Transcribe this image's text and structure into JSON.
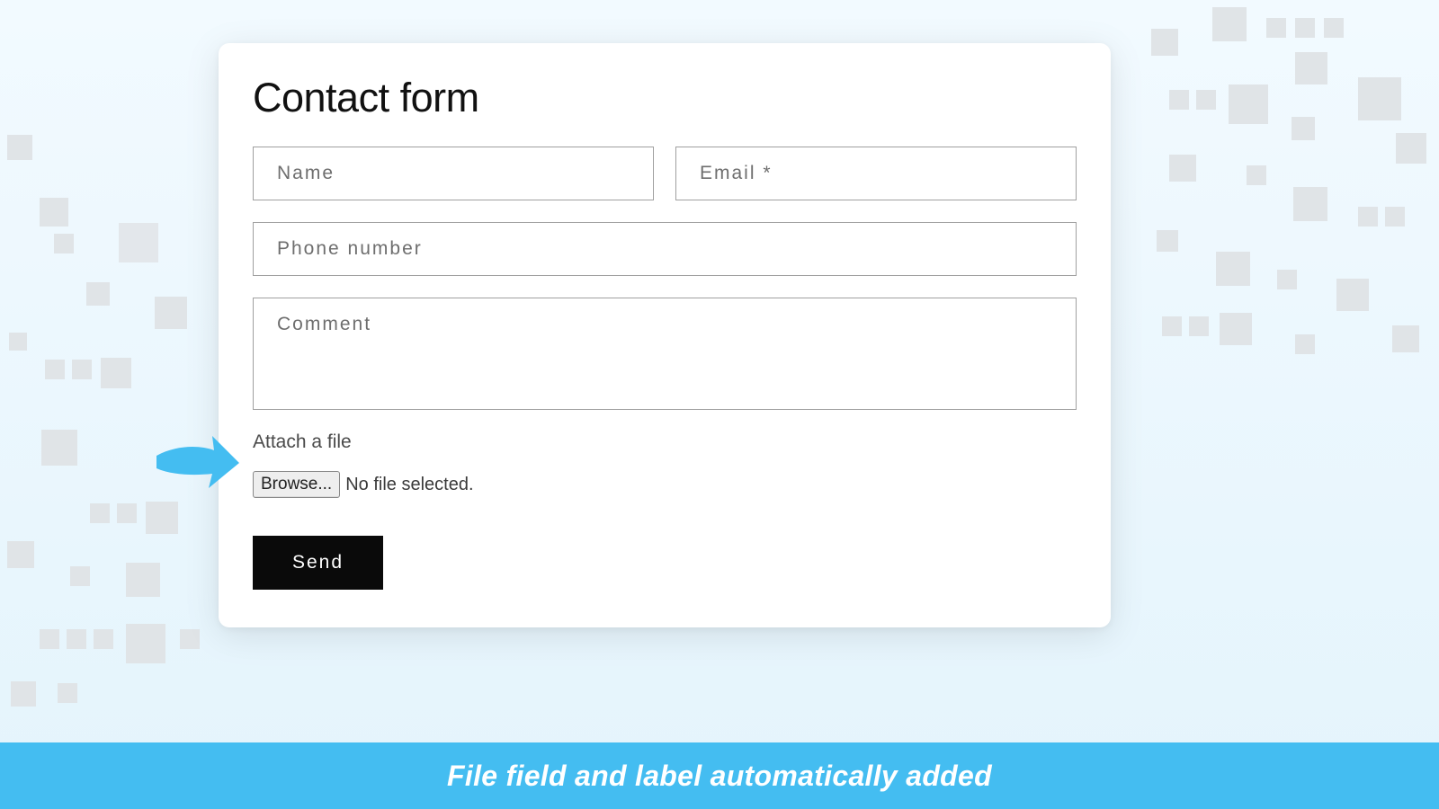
{
  "form": {
    "title": "Contact form",
    "fields": {
      "name_placeholder": "Name",
      "email_placeholder": "Email *",
      "phone_placeholder": "Phone number",
      "comment_placeholder": "Comment"
    },
    "attach": {
      "label": "Attach a file",
      "browse_label": "Browse...",
      "status": "No file selected."
    },
    "submit_label": "Send"
  },
  "callout": {
    "icon": "arrow-right-icon",
    "color": "#44bdf1"
  },
  "footer": {
    "text": "File field and label automatically added"
  }
}
